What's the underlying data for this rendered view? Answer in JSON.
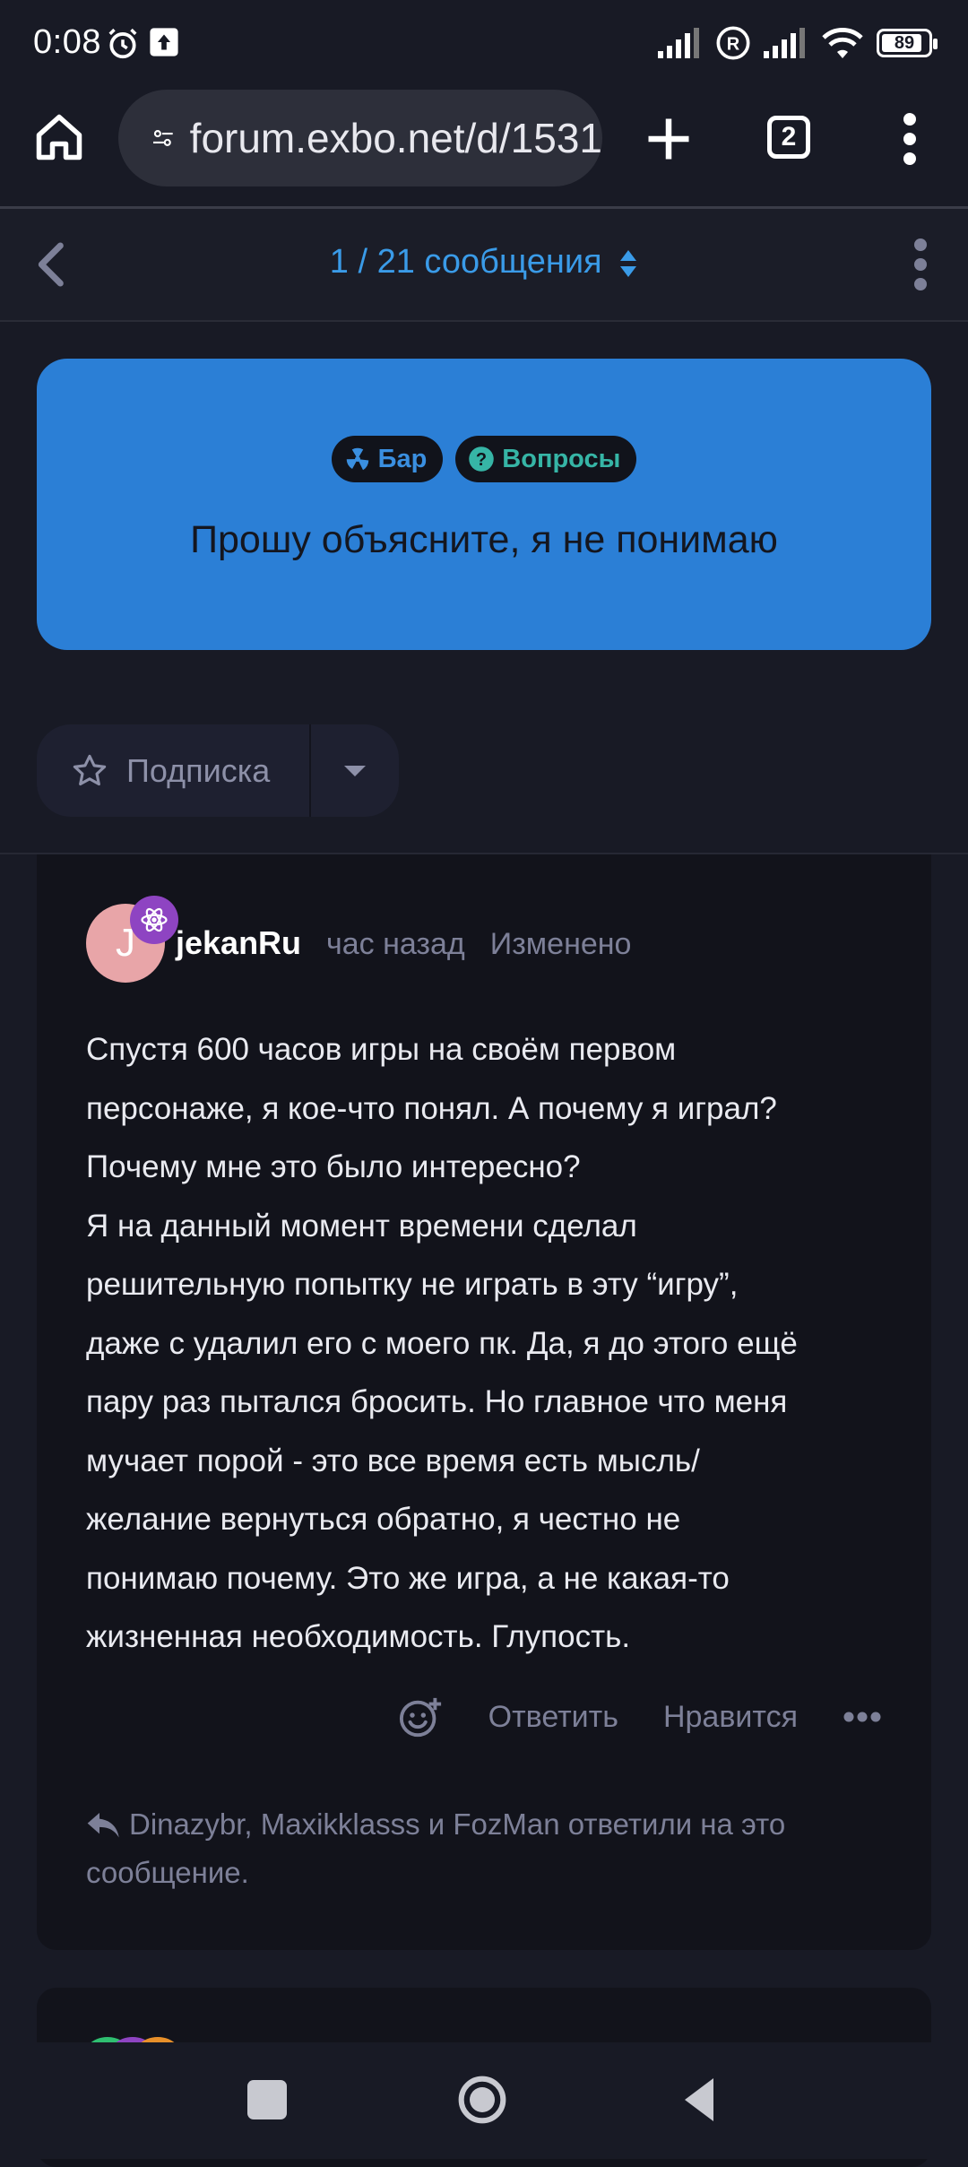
{
  "status_bar": {
    "time": "0:08",
    "battery": "89",
    "icons": [
      "alarm-icon",
      "upload-icon",
      "signal-icon",
      "roaming-icon",
      "signal-icon",
      "wifi-icon",
      "battery-icon"
    ]
  },
  "browser": {
    "url": "forum.exbo.net/d/1531",
    "tab_count": "2"
  },
  "topic_nav": {
    "scrubber": "1 / 21 сообщения"
  },
  "discussion": {
    "tags": [
      {
        "label": "Бар",
        "icon": "radiation-icon",
        "color": "#3a8fe0"
      },
      {
        "label": "Вопросы",
        "icon": "question-circle-icon",
        "color": "#36b5a6"
      }
    ],
    "title": "Прошу объясните, я не понимаю",
    "hero_color": "#2b7fd6",
    "subscribe_label": "Подписка"
  },
  "post": {
    "avatar_letter": "J",
    "avatar_color": "#e8a5a8",
    "username": "jekanRu",
    "time": "час назад",
    "edited": "Изменено",
    "body_lines": [
      "Спустя 600 часов игры на своём первом",
      "персонаже, я кое-что понял. А почему я играл?",
      "Почему мне это было интересно?",
      "Я на данный момент времени сделал",
      "решительную попытку не играть в эту “игру”,",
      "даже с удалил его с моего пк. Да, я до этого ещё",
      "пару раз пытался бросить. Но главное что меня",
      "мучает порой - это все время есть мысль/",
      "желание вернуться обратно, я честно не",
      "понимаю почему. Это же игра, а не какая-то",
      "жизненная необходимость. Глупость."
    ],
    "actions": {
      "reply": "Ответить",
      "like": "Нравится"
    },
    "replies_line1": "Dinazybr, Maxikklasss и FozMan ответили на это",
    "replies_line2": "сообщение."
  }
}
